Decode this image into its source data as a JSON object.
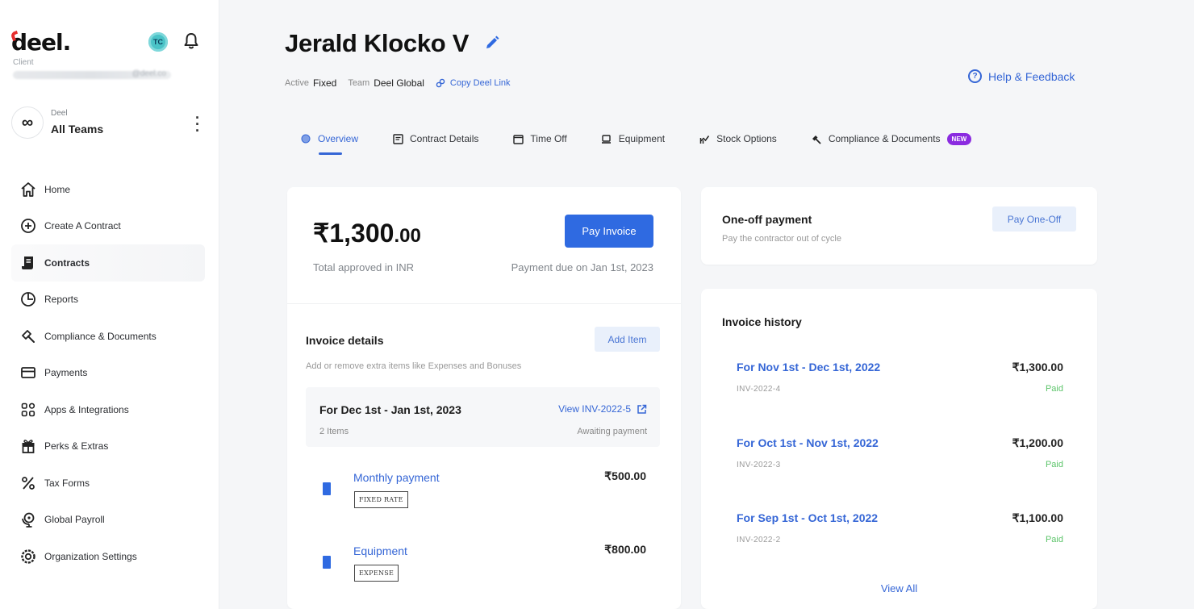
{
  "sidebar": {
    "logo": "deel.",
    "client_label": "Client",
    "email_suffix": "@deel.co",
    "avatar_initials": "TC",
    "team_small": "Deel",
    "team_name": "All Teams",
    "items": [
      {
        "label": "Home",
        "icon": "home-icon"
      },
      {
        "label": "Create A Contract",
        "icon": "plus-circle-icon"
      },
      {
        "label": "Contracts",
        "icon": "contract-icon"
      },
      {
        "label": "Reports",
        "icon": "clock-icon"
      },
      {
        "label": "Compliance & Documents",
        "icon": "hammer-icon"
      },
      {
        "label": "Payments",
        "icon": "card-icon"
      },
      {
        "label": "Apps & Integrations",
        "icon": "apps-icon"
      },
      {
        "label": "Perks & Extras",
        "icon": "gift-icon"
      },
      {
        "label": "Tax Forms",
        "icon": "percent-icon"
      },
      {
        "label": "Global Payroll",
        "icon": "globe-pin-icon"
      },
      {
        "label": "Organization Settings",
        "icon": "settings-icon"
      }
    ]
  },
  "header": {
    "title": "Jerald Klocko V",
    "status_label": "Active",
    "status_value": "Fixed",
    "team_label": "Team",
    "team_value": "Deel Global",
    "copy_link": "Copy Deel Link",
    "help": "Help & Feedback"
  },
  "tabs": [
    {
      "label": "Overview",
      "active": true
    },
    {
      "label": "Contract Details"
    },
    {
      "label": "Time Off"
    },
    {
      "label": "Equipment"
    },
    {
      "label": "Stock Options"
    },
    {
      "label": "Compliance & Documents",
      "badge": "NEW"
    }
  ],
  "summary": {
    "currency": "₹",
    "amount_whole": "1,300",
    "amount_decimal": ".00",
    "total_label": "Total approved in INR",
    "due_label": "Payment due on Jan 1st, 2023",
    "pay_button": "Pay Invoice"
  },
  "invoice_details": {
    "title": "Invoice details",
    "subtitle": "Add or remove extra items like Expenses and Bonuses",
    "add_button": "Add Item",
    "period": "For Dec 1st - Jan 1st, 2023",
    "count": "2 Items",
    "view_link": "View INV-2022-5",
    "status": "Awaiting payment",
    "items": [
      {
        "name": "Monthly payment",
        "tag": "FIXED RATE",
        "amount": "₹500.00"
      },
      {
        "name": "Equipment",
        "tag": "EXPENSE",
        "amount": "₹800.00"
      }
    ]
  },
  "one_off": {
    "title": "One-off payment",
    "subtitle": "Pay the contractor out of cycle",
    "button": "Pay One-Off"
  },
  "history": {
    "title": "Invoice history",
    "rows": [
      {
        "period": "For Nov 1st - Dec 1st, 2022",
        "number": "INV-2022-4",
        "amount": "₹1,300.00",
        "status": "Paid"
      },
      {
        "period": "For Oct 1st - Nov 1st, 2022",
        "number": "INV-2022-3",
        "amount": "₹1,200.00",
        "status": "Paid"
      },
      {
        "period": "For Sep 1st - Oct 1st, 2022",
        "number": "INV-2022-2",
        "amount": "₹1,100.00",
        "status": "Paid"
      }
    ],
    "view_all": "View All"
  },
  "colors": {
    "accent": "#2f6ae1",
    "link": "#3566d6",
    "paid": "#5cc46a",
    "brand_red": "#e62e2e",
    "badge_purple": "#8b2be0"
  }
}
